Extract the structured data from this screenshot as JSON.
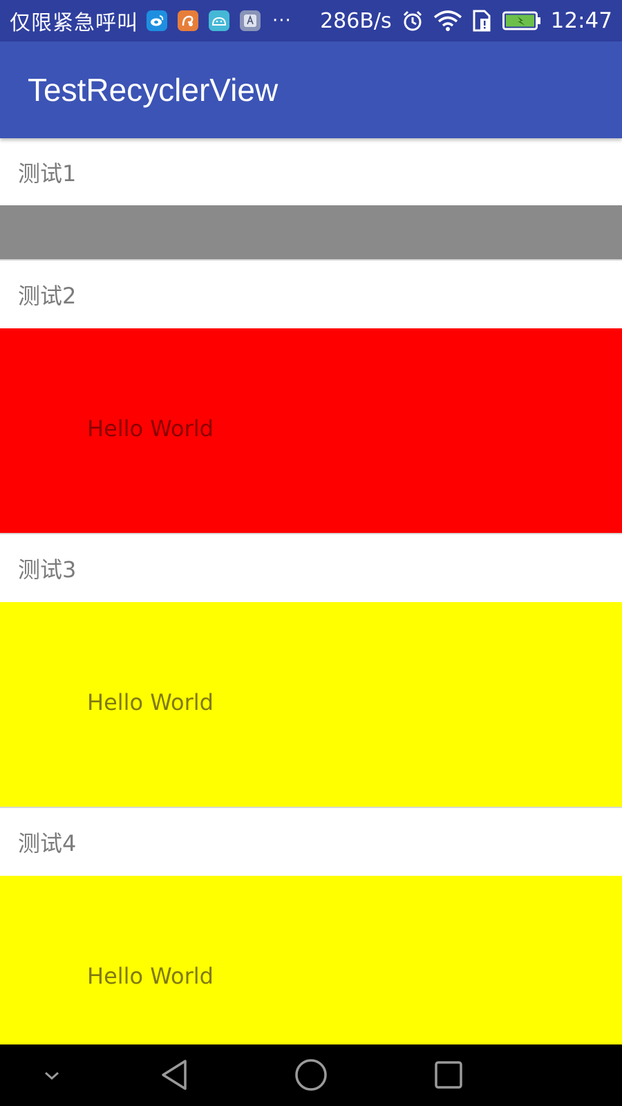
{
  "status_bar": {
    "carrier_text": "仅限紧急呼叫",
    "notification_icons": [
      {
        "name": "weibo-icon",
        "color": "#1e8fe0"
      },
      {
        "name": "uc-browser-icon",
        "color": "#e67e3a"
      },
      {
        "name": "android-icon",
        "color": "#45b8d6"
      },
      {
        "name": "font-a-icon",
        "color": "#8a94b8"
      }
    ],
    "more_text": "···",
    "network_speed": "286B/s",
    "time": "12:47",
    "battery_color": "#6cc04a"
  },
  "app_bar": {
    "title": "TestRecyclerView",
    "color": "#3c54b5"
  },
  "list": {
    "items": [
      {
        "title": "测试1",
        "body_color": "#8a8a8a",
        "body_text": ""
      },
      {
        "title": "测试2",
        "body_color": "#ff0000",
        "body_text": "Hello World",
        "text_color": "#8b0000"
      },
      {
        "title": "测试3",
        "body_color": "#ffff00",
        "body_text": "Hello World",
        "text_color": "#807a10"
      },
      {
        "title": "测试4",
        "body_color": "#ffff00",
        "body_text": "Hello World",
        "text_color": "#807a10"
      }
    ]
  },
  "nav_bar": {
    "buttons": [
      "collapse-chevron",
      "back",
      "home",
      "recents"
    ]
  }
}
